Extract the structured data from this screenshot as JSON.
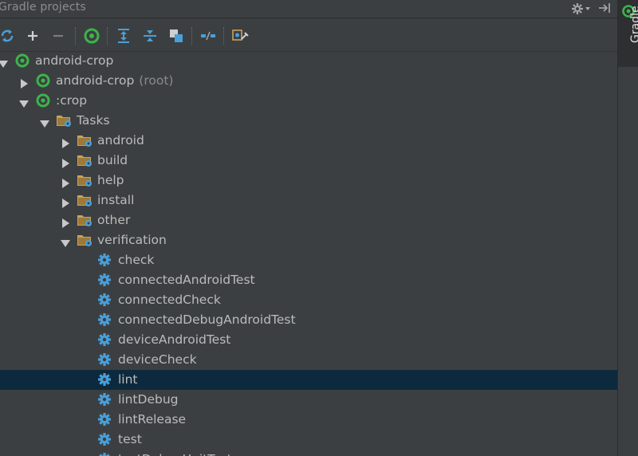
{
  "panel": {
    "title": "Gradle projects"
  },
  "side_tab": {
    "label": "Gradle"
  },
  "toolbar": {
    "buttons": [
      {
        "name": "refresh-all-button",
        "icon": "refresh-icon"
      },
      {
        "name": "link-project-button",
        "icon": "plus-icon"
      },
      {
        "name": "detach-project-button",
        "icon": "minus-icon"
      },
      {
        "name": "execute-task-button",
        "icon": "gradle-icon"
      },
      {
        "name": "expand-all-button",
        "icon": "expand-all-icon"
      },
      {
        "name": "collapse-all-button",
        "icon": "collapse-all-icon"
      },
      {
        "name": "group-tasks-button",
        "icon": "group-icon"
      },
      {
        "name": "toggle-offline-button",
        "icon": "offline-icon"
      },
      {
        "name": "settings-button",
        "icon": "wrench-icon"
      }
    ]
  },
  "tree": {
    "items": [
      {
        "label": "android-crop",
        "suffix": "",
        "kind": "project",
        "state": "expanded",
        "depth": 0
      },
      {
        "label": "android-crop",
        "suffix": "(root)",
        "kind": "project",
        "state": "collapsed",
        "depth": 1
      },
      {
        "label": ":crop",
        "suffix": "",
        "kind": "project",
        "state": "expanded",
        "depth": 1
      },
      {
        "label": "Tasks",
        "suffix": "",
        "kind": "folder",
        "state": "expanded",
        "depth": 2
      },
      {
        "label": "android",
        "suffix": "",
        "kind": "folder",
        "state": "collapsed",
        "depth": 3
      },
      {
        "label": "build",
        "suffix": "",
        "kind": "folder",
        "state": "collapsed",
        "depth": 3
      },
      {
        "label": "help",
        "suffix": "",
        "kind": "folder",
        "state": "collapsed",
        "depth": 3
      },
      {
        "label": "install",
        "suffix": "",
        "kind": "folder",
        "state": "collapsed",
        "depth": 3
      },
      {
        "label": "other",
        "suffix": "",
        "kind": "folder",
        "state": "collapsed",
        "depth": 3
      },
      {
        "label": "verification",
        "suffix": "",
        "kind": "folder",
        "state": "expanded",
        "depth": 3
      },
      {
        "label": "check",
        "suffix": "",
        "kind": "task",
        "state": "leaf",
        "depth": 4
      },
      {
        "label": "connectedAndroidTest",
        "suffix": "",
        "kind": "task",
        "state": "leaf",
        "depth": 4
      },
      {
        "label": "connectedCheck",
        "suffix": "",
        "kind": "task",
        "state": "leaf",
        "depth": 4
      },
      {
        "label": "connectedDebugAndroidTest",
        "suffix": "",
        "kind": "task",
        "state": "leaf",
        "depth": 4
      },
      {
        "label": "deviceAndroidTest",
        "suffix": "",
        "kind": "task",
        "state": "leaf",
        "depth": 4
      },
      {
        "label": "deviceCheck",
        "suffix": "",
        "kind": "task",
        "state": "leaf",
        "depth": 4
      },
      {
        "label": "lint",
        "suffix": "",
        "kind": "task",
        "state": "leaf",
        "depth": 4,
        "selected": true
      },
      {
        "label": "lintDebug",
        "suffix": "",
        "kind": "task",
        "state": "leaf",
        "depth": 4
      },
      {
        "label": "lintRelease",
        "suffix": "",
        "kind": "task",
        "state": "leaf",
        "depth": 4
      },
      {
        "label": "test",
        "suffix": "",
        "kind": "task",
        "state": "leaf",
        "depth": 4
      },
      {
        "label": "testDebugUnitTest",
        "suffix": "",
        "kind": "task",
        "state": "leaf",
        "depth": 4
      }
    ]
  },
  "colors": {
    "background": "#3c3f41",
    "selection": "#0d293e",
    "gradle_green": "#3cb44a",
    "gear_blue": "#4a9fd8",
    "folder": "#c9a35a"
  }
}
